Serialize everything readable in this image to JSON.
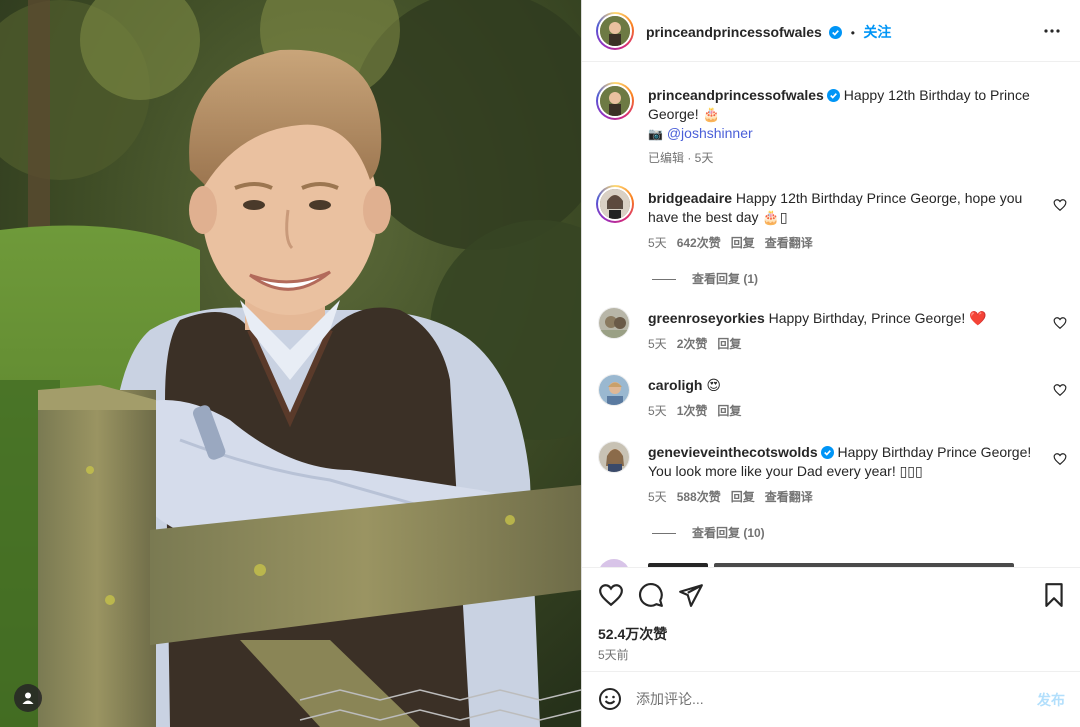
{
  "post": {
    "username": "princeandprincessofwales",
    "follow_label": "关注",
    "separator": "•",
    "caption": {
      "username": "princeandprincessofwales",
      "text_line1": "Happy 12th Birthday to Prince",
      "text_line2": "George! 🎂",
      "camera_emoji": "📷",
      "credit": "@joshshinner",
      "meta": "已编辑 · 5天"
    },
    "likes": "52.4万次赞",
    "time": "5天前"
  },
  "comments": [
    {
      "username": "bridgeadaire",
      "text_line1": "Happy 12th Birthday Prince George, hope you",
      "text_line2": "have the best day 🎂▯",
      "time": "5天",
      "likes": "642次赞",
      "reply": "回复",
      "translate": "查看翻译",
      "view_replies": "查看回复 (1)"
    },
    {
      "username": "greenroseyorkies",
      "text_line1": "Happy Birthday, Prince George! ❤️",
      "time": "5天",
      "likes": "2次赞",
      "reply": "回复"
    },
    {
      "username": "caroligh",
      "text_line1": "😍",
      "time": "5天",
      "likes": "1次赞",
      "reply": "回复"
    },
    {
      "username": "genevieveinthecotswolds",
      "text_line1": "Happy Birthday Prince George!",
      "text_line2": "You look more like your Dad every year! ▯▯▯",
      "time": "5天",
      "likes": "588次赞",
      "reply": "回复",
      "translate": "查看翻译",
      "view_replies": "查看回复 (10)"
    }
  ],
  "add_comment": {
    "placeholder": "添加评论...",
    "publish": "发布"
  },
  "icons": {
    "more": "more-icon",
    "like": "heart-icon",
    "comment": "comment-icon",
    "share": "share-icon",
    "save": "bookmark-icon",
    "emoji": "emoji-icon",
    "user": "user-tag-icon"
  },
  "colors": {
    "accent": "#0095f6",
    "verified": "#0095f6",
    "heart_red": "#ed4956"
  }
}
